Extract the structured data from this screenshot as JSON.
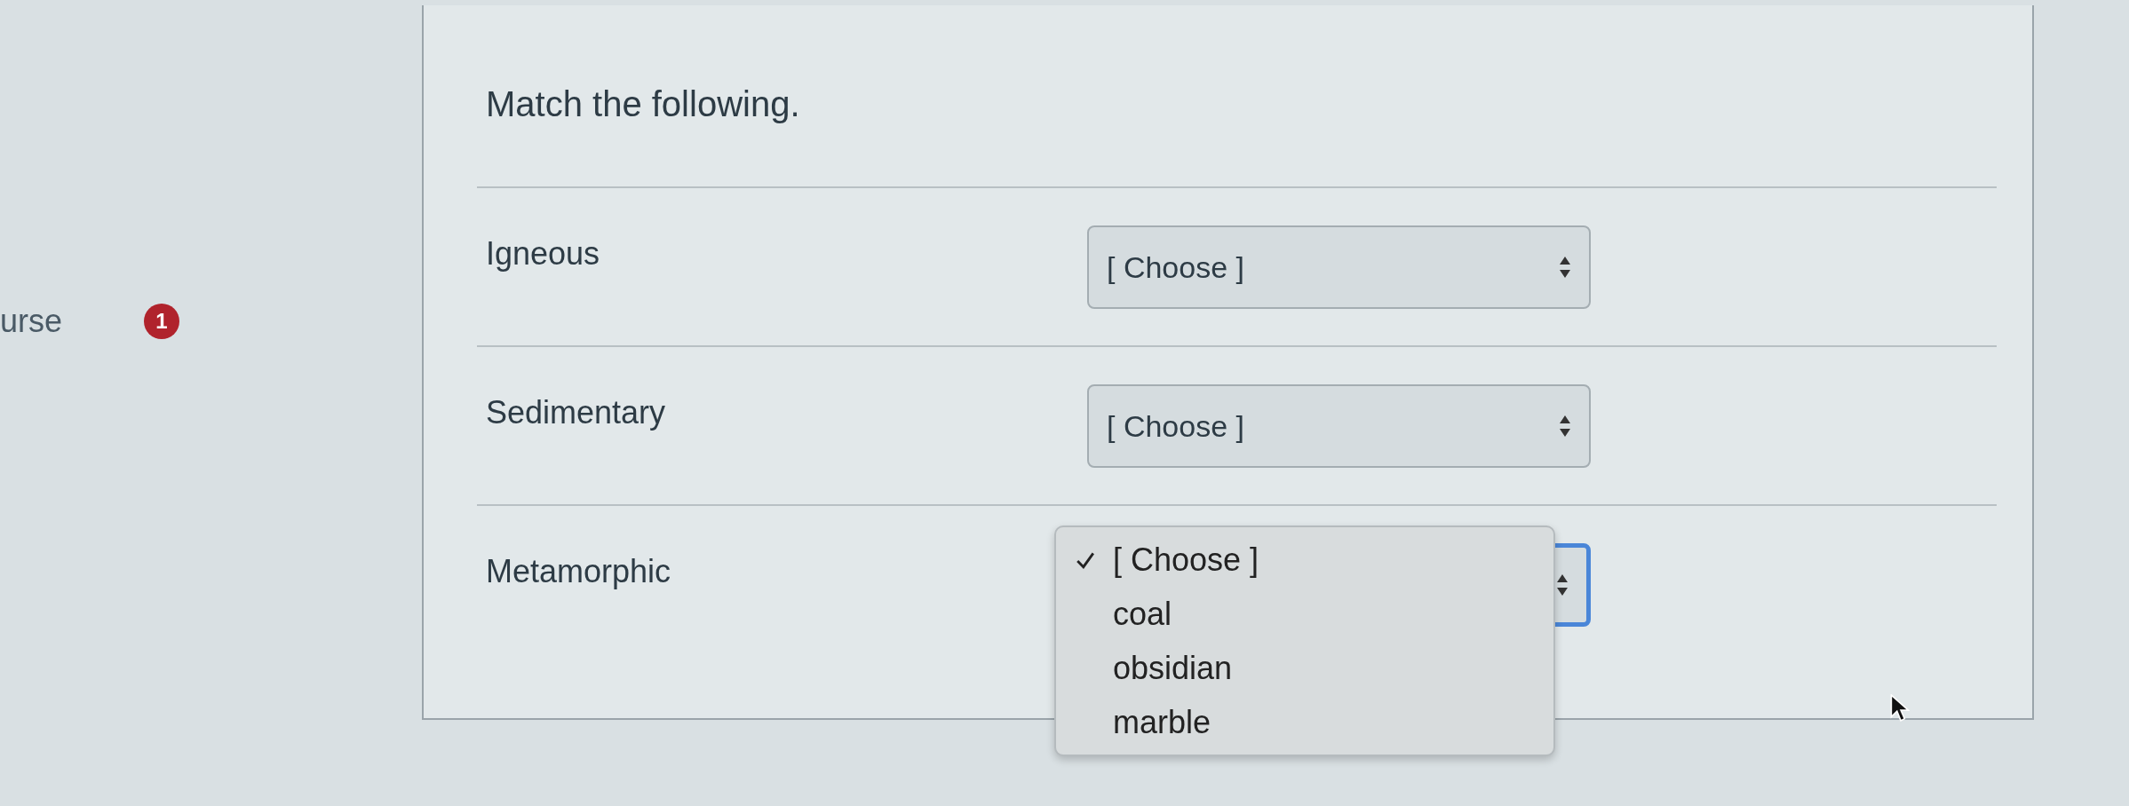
{
  "sidebar": {
    "label": "urse",
    "badge": "1"
  },
  "question": {
    "prompt": "Match the following.",
    "rows": [
      {
        "label": "Igneous",
        "select": {
          "value": "[ Choose ]",
          "focused": false,
          "open": false
        }
      },
      {
        "label": "Sedimentary",
        "select": {
          "value": "[ Choose ]",
          "focused": false,
          "open": false
        }
      },
      {
        "label": "Metamorphic",
        "select": {
          "focused": true,
          "open": true,
          "options": [
            {
              "label": "[ Choose ]",
              "selected": true
            },
            {
              "label": "coal",
              "selected": false
            },
            {
              "label": "obsidian",
              "selected": false
            },
            {
              "label": "marble",
              "selected": false
            }
          ]
        }
      }
    ]
  }
}
